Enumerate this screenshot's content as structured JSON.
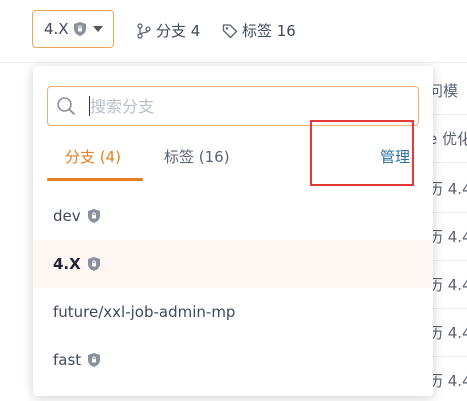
{
  "toolbar": {
    "current_branch": "4.X",
    "branches_label": "分支 4",
    "tags_label": "标签 16"
  },
  "dropdown": {
    "search_placeholder": "搜索分支",
    "tabs": [
      {
        "label": "分支 (4)",
        "active": true
      },
      {
        "label": "标签 (16)",
        "active": false
      }
    ],
    "manage_label": "管理",
    "items": [
      {
        "name": "dev",
        "protected": true,
        "selected": false
      },
      {
        "name": "4.X",
        "protected": true,
        "selected": true
      },
      {
        "name": "future/xxl-job-admin-mp",
        "protected": false,
        "selected": false
      },
      {
        "name": "fast",
        "protected": true,
        "selected": false
      }
    ]
  },
  "background": {
    "rows": [
      "问模",
      "e 优化",
      "历 4.4",
      "历 4.4",
      "历 4.4",
      "历 4.4",
      "历 4.4"
    ]
  },
  "colors": {
    "accent": "#e67e22",
    "link": "#2f6f9f",
    "highlight": "#e53935"
  },
  "icons": [
    "shield-icon",
    "caret-down-icon",
    "branch-icon",
    "tag-icon",
    "search-icon"
  ]
}
